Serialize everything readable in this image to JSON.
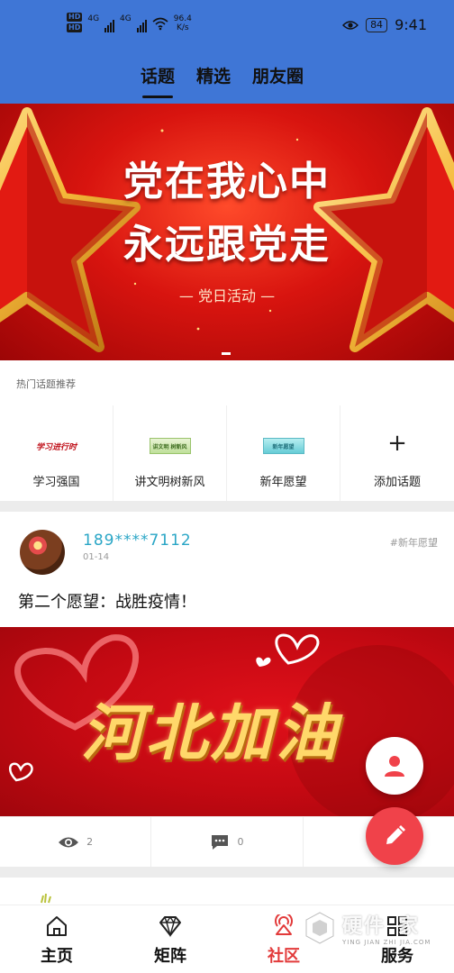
{
  "status_bar": {
    "hd1": "HD",
    "hd2": "HD",
    "net1": "4G",
    "net2": "4G",
    "speed_value": "96.4",
    "speed_unit": "K/s",
    "battery": "84",
    "time": "9:41"
  },
  "tabs": [
    {
      "label": "话题",
      "active": true
    },
    {
      "label": "精选",
      "active": false
    },
    {
      "label": "朋友圈",
      "active": false
    }
  ],
  "banner": {
    "line1": "党在我心中",
    "line2": "永远跟党走",
    "subtitle": "— 党日活动 —"
  },
  "hot_topics": {
    "title": "热门话题推荐",
    "items": [
      {
        "label": "学习强国",
        "thumb": "学习进行时"
      },
      {
        "label": "讲文明树新风",
        "thumb": "讲文明 树新风"
      },
      {
        "label": "新年愿望",
        "thumb": "新年愿望"
      },
      {
        "label": "添加话题",
        "thumb": "+"
      }
    ]
  },
  "post": {
    "username": "189****7112",
    "date": "01-14",
    "tag": "#新年愿望",
    "text": "第二个愿望：战胜疫情！",
    "image_text": "河北加油",
    "views": "2",
    "comments": "0"
  },
  "bottom_nav": [
    {
      "label": "主页",
      "icon": "home-icon",
      "active": false
    },
    {
      "label": "矩阵",
      "icon": "diamond-icon",
      "active": false
    },
    {
      "label": "社区",
      "icon": "community-icon",
      "active": true
    },
    {
      "label": "服务",
      "icon": "grid-icon",
      "active": false
    }
  ],
  "watermark": {
    "text": "硬件",
    "text2": "家",
    "sub": "YING JIAN ZHI JIA.COM"
  },
  "colors": {
    "header": "#3f76d6",
    "accent_red": "#e23b3b",
    "username": "#2aa6c6",
    "fab_edit": "#f0424a"
  }
}
